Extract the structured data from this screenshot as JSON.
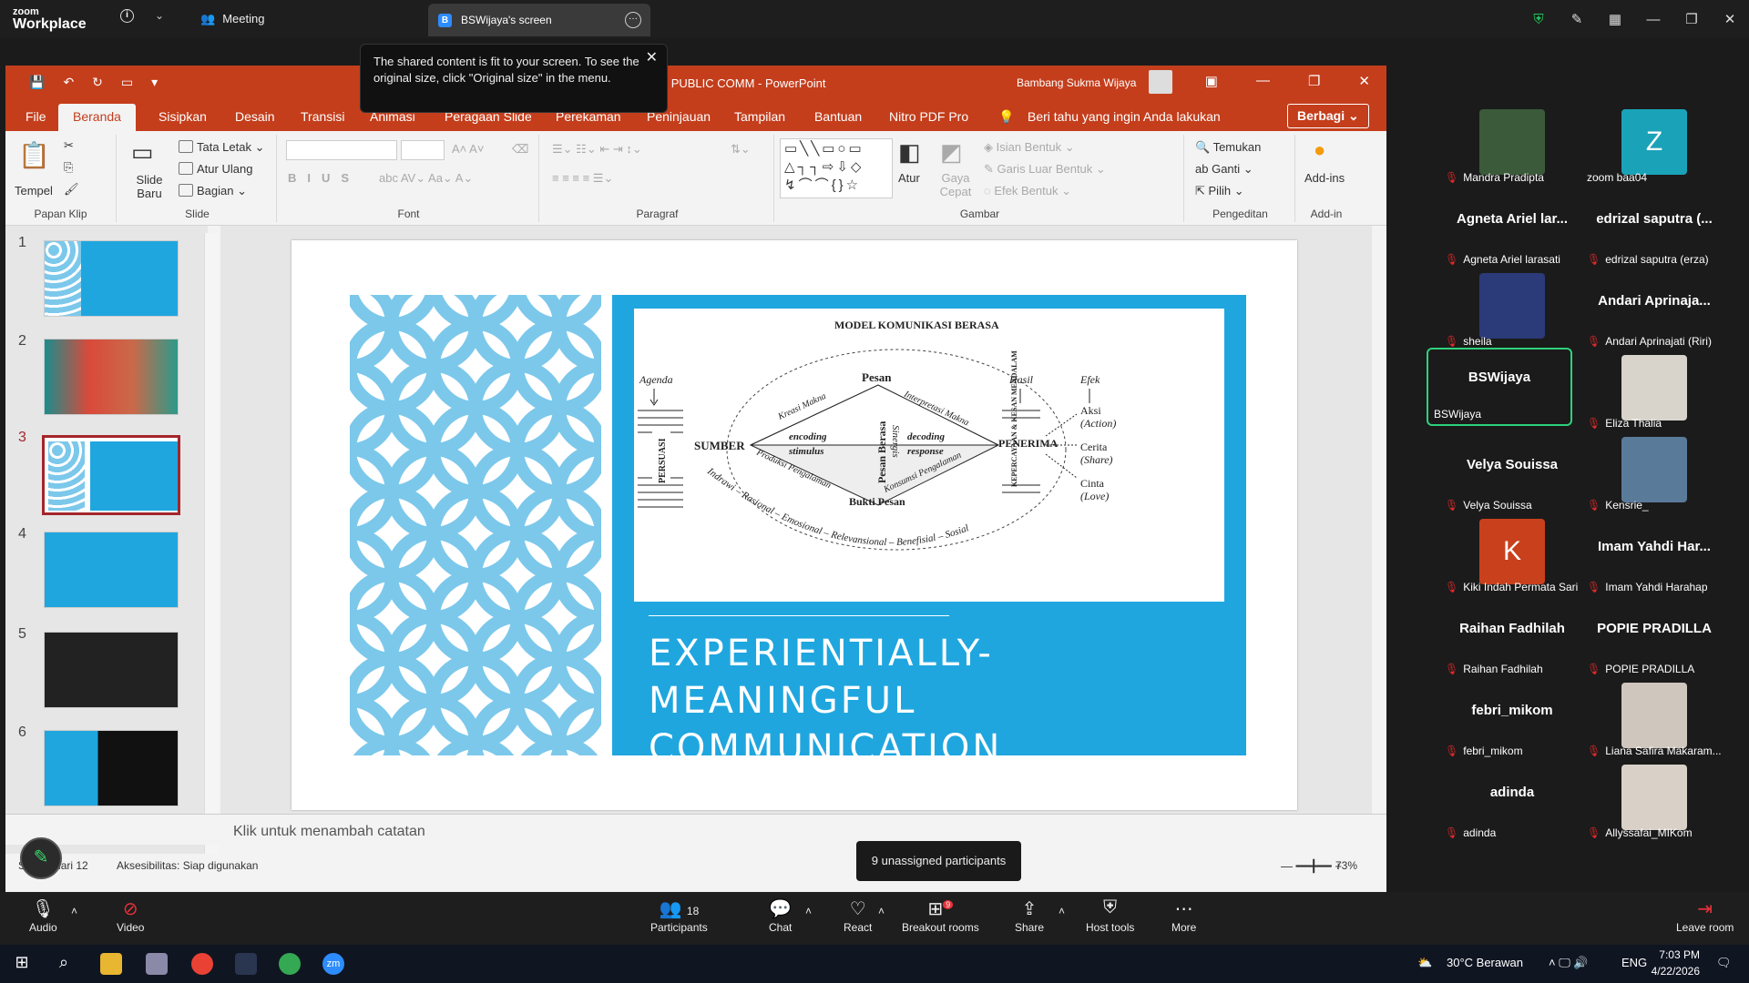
{
  "zoom": {
    "logo_top": "zoom",
    "logo_bottom": "Workplace",
    "meeting_label": "Meeting",
    "screen_tab_badge": "B",
    "screen_tab_label": "BSWijaya's screen",
    "tooltip_text": "The shared content is fit to your screen. To see the original size, click \"Original size\" in the menu.",
    "unassigned": "9 unassigned participants",
    "participants_count": "18",
    "breakout_badge": "9",
    "toolbar": [
      {
        "name": "audio",
        "label": "Audio",
        "icon": "mic-icon"
      },
      {
        "name": "video",
        "label": "Video",
        "icon": "camera-off-icon"
      },
      {
        "name": "participants",
        "label": "Participants",
        "icon": "people-icon"
      },
      {
        "name": "chat",
        "label": "Chat",
        "icon": "chat-icon"
      },
      {
        "name": "react",
        "label": "React",
        "icon": "heart-icon"
      },
      {
        "name": "breakout",
        "label": "Breakout rooms",
        "icon": "grid-icon"
      },
      {
        "name": "share",
        "label": "Share",
        "icon": "share-icon"
      },
      {
        "name": "hosttools",
        "label": "Host tools",
        "icon": "shield-icon"
      },
      {
        "name": "more",
        "label": "More",
        "icon": "dots-icon"
      },
      {
        "name": "leave",
        "label": "Leave room",
        "icon": "exit-icon"
      }
    ]
  },
  "ppt": {
    "title": "KOMUNIKASI BERASA IN CORP & PUBLIC COMM  -  PowerPoint",
    "user": "Bambang Sukma Wijaya",
    "menu": [
      "File",
      "Beranda",
      "Sisipkan",
      "Desain",
      "Transisi",
      "Animasi",
      "Peragaan Slide",
      "Perekaman",
      "Peninjauan",
      "Tampilan",
      "Bantuan",
      "Nitro PDF Pro"
    ],
    "tell_me": "Beri tahu yang ingin Anda lakukan",
    "share": "Berbagi",
    "ribbon": {
      "tempel": "Tempel",
      "papan_klip": "Papan Klip",
      "slide_baru": "Slide Baru",
      "tata_letak": "Tata Letak",
      "atur_ulang": "Atur Ulang",
      "bagian": "Bagian",
      "slide_group": "Slide",
      "font_group": "Font",
      "paragraf_group": "Paragraf",
      "atur": "Atur",
      "gaya_cepat": "Gaya Cepat",
      "isian_bentuk": "Isian Bentuk",
      "garis_luar": "Garis Luar Bentuk",
      "efek_bentuk": "Efek Bentuk",
      "gambar_group": "Gambar",
      "temukan": "Temukan",
      "ganti": "Ganti",
      "pilih": "Pilih",
      "pengeditan_group": "Pengeditan",
      "addins": "Add-ins",
      "addin_group": "Add-in"
    },
    "thumb_numbers": [
      "1",
      "2",
      "3",
      "4",
      "5",
      "6"
    ],
    "slide": {
      "figure_title": "MODEL KOMUNIKASI BERASA",
      "agenda": "Agenda",
      "persuasi": "PERSUASI",
      "sumber": "SUMBER",
      "pesan": "Pesan",
      "kreasi": "Kreasi Makna",
      "interpretasi": "Interpretasi Makna",
      "encoding": "encoding",
      "stimulus": "stimulus",
      "pesan_berasa": "Pesan Berasa",
      "sinergis": "Sinergis",
      "decoding": "decoding",
      "response": "response",
      "produksi": "Produksi Pengalaman",
      "konsumsi": "Konsumsi Pengalaman",
      "bukti": "Bukti Pesan",
      "penerima": "PENERIMA",
      "hasil": "Hasil",
      "kepercayaan": "KEPERCAYAAN & KESAN MENDALAM",
      "efek": "Efek",
      "aksi": "Aksi",
      "action": "(Action)",
      "cerita": "Cerita",
      "share": "(Share)",
      "cinta": "Cinta",
      "love": "(Love)",
      "arc": "Indrawi – Rasional – Emosional – Relevansional – Benefisial – Sosial",
      "title1": "EXPERIENTIALLY-MEANINGFUL",
      "title2": "COMMUNICATION"
    },
    "notes": "Klik untuk menambah catatan",
    "status_slide": "Slide 3 dari 12",
    "status_access": "Aksesibilitas: Siap digunakan",
    "zoom_pct": "73%"
  },
  "gallery": [
    {
      "big": "",
      "label": "Mandra Pradipta",
      "avatar": "#3a5a3a"
    },
    {
      "big": "Z",
      "label": "zoom baa04",
      "avatar": "#1aa3b8"
    },
    {
      "big": "Agneta Ariel lar...",
      "label": "Agneta Ariel larasati",
      "avatar": ""
    },
    {
      "big": "edrizal saputra (...",
      "label": "edrizal saputra (erza)",
      "avatar": ""
    },
    {
      "big": "",
      "label": "sheila",
      "avatar": "#2b3a78"
    },
    {
      "big": "Andari  Aprinaja...",
      "label": "Andari Aprinajati (Riri)",
      "avatar": ""
    },
    {
      "big": "BSWijaya",
      "label": "BSWijaya",
      "avatar": ""
    },
    {
      "big": "",
      "label": "Eliza Thalia",
      "avatar": "#d8d4cc"
    },
    {
      "big": "Velya Souissa",
      "label": "Velya Souissa",
      "avatar": ""
    },
    {
      "big": "",
      "label": "Kensrie_",
      "avatar": "#5a7a9a"
    },
    {
      "big": "K",
      "label": "Kiki Indah Permata Sari",
      "avatar": "#c9401c"
    },
    {
      "big": "Imam Yahdi Har...",
      "label": "Imam Yahdi Harahap",
      "avatar": ""
    },
    {
      "big": "Raihan Fadhilah",
      "label": "Raihan Fadhilah",
      "avatar": ""
    },
    {
      "big": "POPIE PRADILLA",
      "label": "POPIE PRADILLA",
      "avatar": ""
    },
    {
      "big": "febri_mikom",
      "label": "febri_mikom",
      "avatar": ""
    },
    {
      "big": "",
      "label": "Liana Safira Makaram...",
      "avatar": "#cfc6bd"
    },
    {
      "big": "adinda",
      "label": "adinda",
      "avatar": ""
    },
    {
      "big": "",
      "label": "Allyssafai_MIKom",
      "avatar": "#d9d0c8"
    }
  ],
  "taskbar": {
    "weather": "30°C  Berawan",
    "lang": "ENG",
    "time": "7:03 PM",
    "date": "4/22/2026",
    "notif": "1"
  }
}
